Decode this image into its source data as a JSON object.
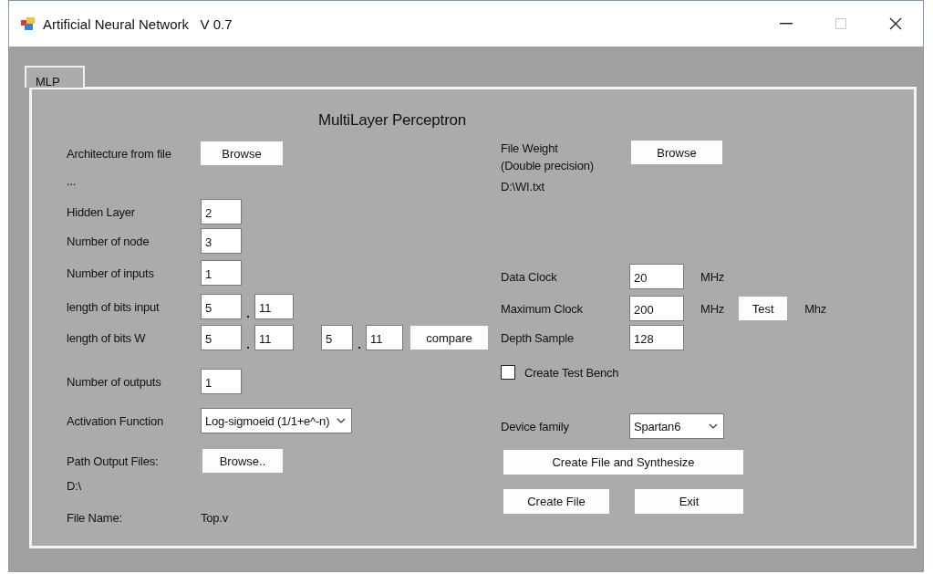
{
  "window": {
    "title": "Artificial Neural Network   V 0.7"
  },
  "tabs": [
    {
      "label": "MLP",
      "selected": true
    }
  ],
  "heading": "MultiLayer Perceptron",
  "architecture": {
    "label": "Architecture from file",
    "button": "Browse",
    "path": "..."
  },
  "parameters": [
    {
      "kind": "number",
      "label": "Hidden Layer",
      "values": [
        "2"
      ]
    },
    {
      "kind": "number",
      "label": "Number of node",
      "values": [
        "3"
      ]
    },
    {
      "kind": "number",
      "label": "Number of inputs",
      "values": [
        "1"
      ]
    },
    {
      "kind": "fixed",
      "label": "length of bits input",
      "values": [
        "5",
        "11"
      ],
      "separator": "."
    },
    {
      "kind": "compare",
      "label": "length of bits W",
      "values": [
        "5",
        "11",
        "5",
        "11"
      ],
      "separator": ".",
      "button": "compare"
    },
    {
      "kind": "number",
      "label": "Number of outputs",
      "values": [
        "1"
      ]
    }
  ],
  "activation": {
    "label": "Activation Function",
    "value": "Log-sigmoeid (1/1+e^-n)"
  },
  "output_path": {
    "label": "Path Output Files:",
    "button": "Browse..",
    "path": "D:\\"
  },
  "file_name": {
    "label": "File Name:",
    "value": "Top.v"
  },
  "weights": {
    "label_lines": [
      "File Weight",
      "(Double precision)"
    ],
    "button": "Browse",
    "path": "D:\\WI.txt"
  },
  "clocks": [
    {
      "label": "Data Clock",
      "value": "20",
      "unit": "MHz"
    },
    {
      "label": "Maximum Clock",
      "value": "200",
      "unit": "MHz",
      "button": "Test",
      "result_unit": "Mhz"
    },
    {
      "label": "Depth Sample",
      "value": "128"
    }
  ],
  "test_bench": {
    "label": "Create Test Bench",
    "checked": false
  },
  "device": {
    "label": "Device family",
    "value": "Spartan6"
  },
  "actions": [
    "Create File and Synthesize",
    "Create File",
    "Exit"
  ]
}
